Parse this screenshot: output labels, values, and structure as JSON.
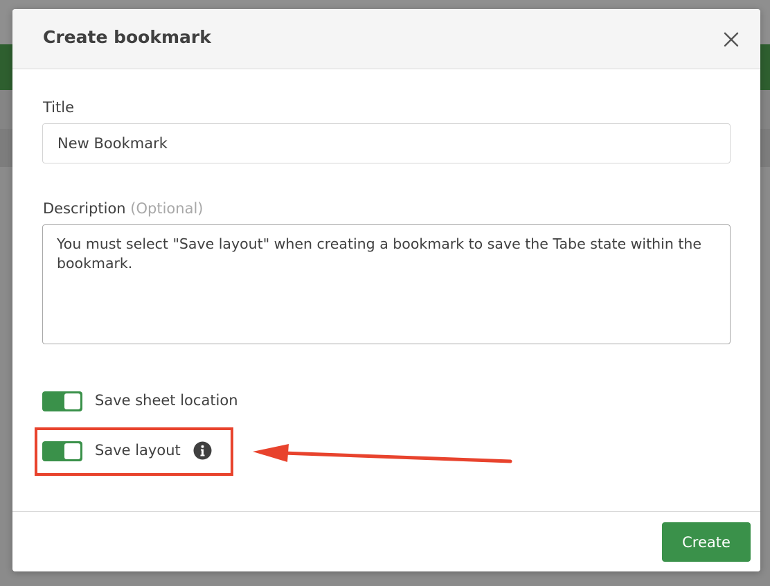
{
  "dialog": {
    "title": "Create bookmark",
    "close_icon": "close-icon"
  },
  "form": {
    "title_label": "Title",
    "title_value": "New Bookmark",
    "description_label": "Description",
    "description_optional": "(Optional)",
    "description_value": "You must select \"Save layout\" when creating a bookmark to save the Tabe state within the bookmark."
  },
  "toggles": [
    {
      "label": "Save sheet location",
      "checked": true
    },
    {
      "label": "Save layout",
      "checked": true,
      "info_icon": "info-icon"
    }
  ],
  "footer": {
    "create_label": "Create"
  },
  "colors": {
    "accent_green": "#3a914a",
    "annotation_red": "#e8432d",
    "overlay": "#8a8a8a"
  }
}
